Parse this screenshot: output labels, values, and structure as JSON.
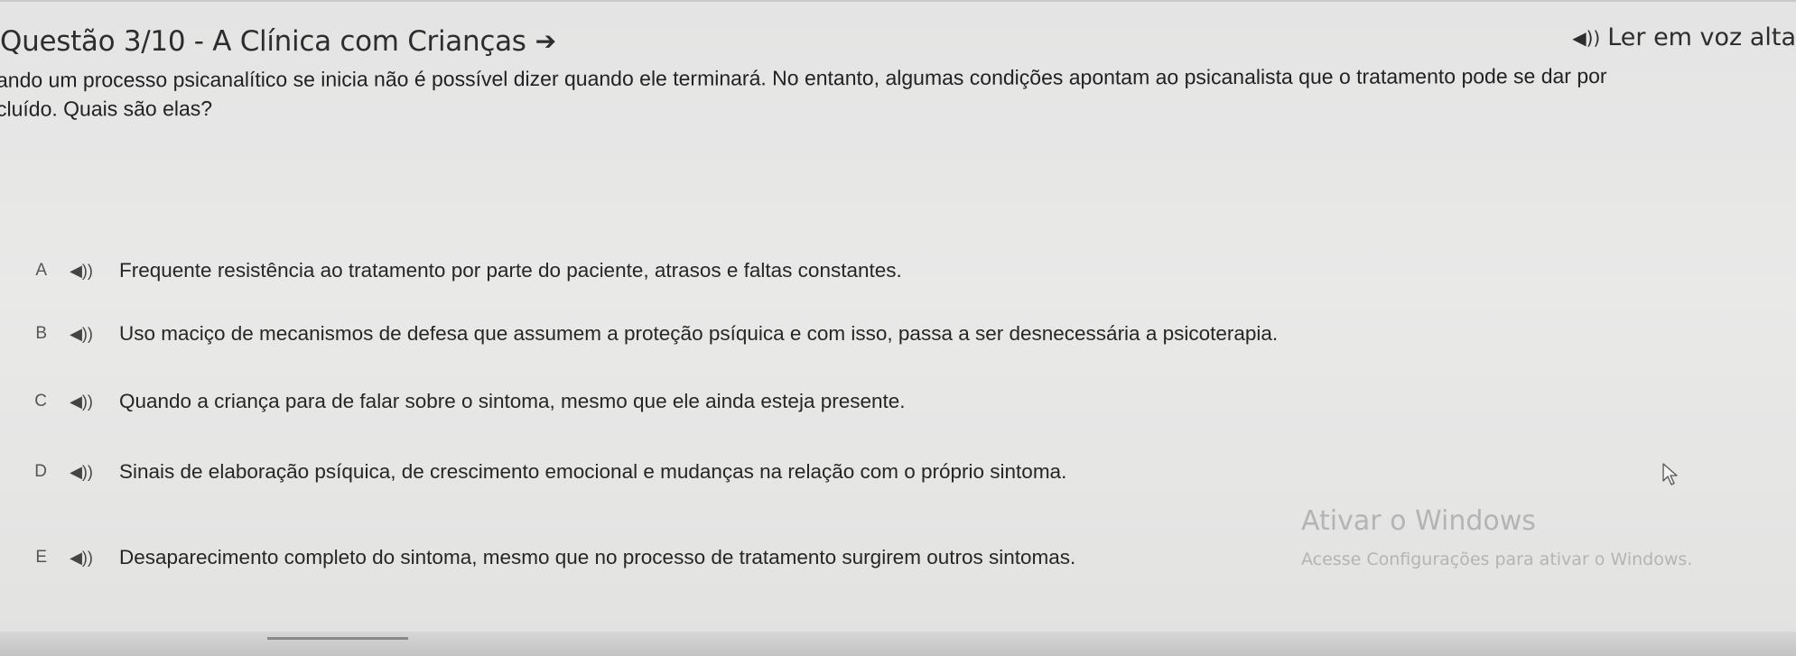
{
  "header": {
    "title": "Questão 3/10 - A Clínica com Crianças",
    "read_aloud_label": "Ler em voz alta"
  },
  "question": {
    "line1": "ando um processo psicanalítico se inicia não é possível dizer quando ele terminará. No entanto, algumas condições apontam ao psicanalista que o tratamento pode se dar por",
    "line2": "cluído. Quais são elas?"
  },
  "options": [
    {
      "letter": "A",
      "text": "Frequente resistência ao tratamento por parte do paciente, atrasos e faltas constantes."
    },
    {
      "letter": "B",
      "text": "Uso maciço de mecanismos de defesa que assumem a proteção psíquica e com isso, passa a ser desnecessária a psicoterapia."
    },
    {
      "letter": "C",
      "text": "Quando a criança para de falar sobre o sintoma, mesmo que ele ainda esteja presente."
    },
    {
      "letter": "D",
      "text": "Sinais de elaboração psíquica, de crescimento emocional e mudanças na relação com o próprio sintoma."
    },
    {
      "letter": "E",
      "text": "Desaparecimento completo do sintoma, mesmo que no processo de tratamento surgirem outros sintomas."
    }
  ],
  "watermark": {
    "line1": "Ativar o Windows",
    "line2": "Acesse Configurações para ativar o Windows."
  },
  "icons": {
    "speaker": "speaker-icon",
    "arrow": "arrow-right-icon",
    "cursor": "mouse-pointer-icon"
  }
}
